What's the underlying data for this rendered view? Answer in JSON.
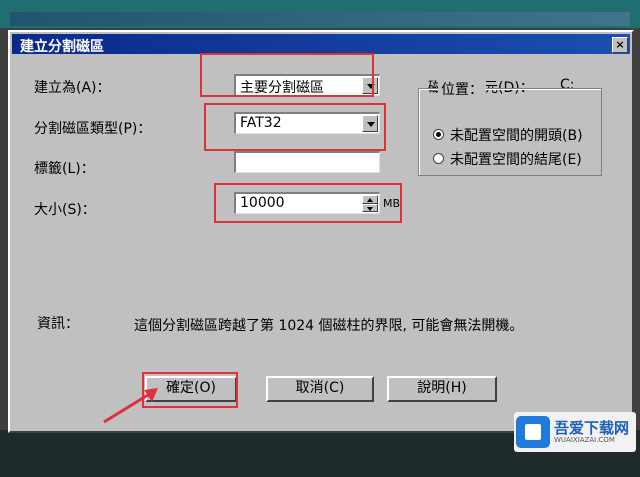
{
  "dialog": {
    "title": "建立分割磁區",
    "close": "×"
  },
  "fields": {
    "create_as_label": "建立為(A)：",
    "create_as_value": "主要分割磁區",
    "fs_type_label": "分割磁區類型(P)：",
    "fs_type_value": "FAT32",
    "tag_label": "標籤(L)：",
    "tag_value": "",
    "size_label": "大小(S)：",
    "size_value": "10000",
    "size_unit": "MB",
    "drive_letter_label": "磁碟機字元(D)：",
    "drive_letter_value": "C:"
  },
  "position_group": {
    "title": "位置：",
    "options": [
      {
        "label": "未配置空間的開頭(B)",
        "checked": true
      },
      {
        "label": "未配置空間的結尾(E)",
        "checked": false
      }
    ]
  },
  "info": {
    "label": "資訊：",
    "message": "這個分割磁區跨越了第 1024 個磁柱的界限, 可能會無法開機。"
  },
  "buttons": {
    "ok": "確定(O)",
    "cancel": "取消(C)",
    "help": "說明(H)"
  },
  "watermark": {
    "title": "吾爱下载网",
    "subtitle": "WUAIXIAZAI.COM"
  },
  "colors": {
    "highlight": "#e0303a",
    "titlebar": "#0a2a8a",
    "dialog_bg": "#c0c0c0"
  }
}
